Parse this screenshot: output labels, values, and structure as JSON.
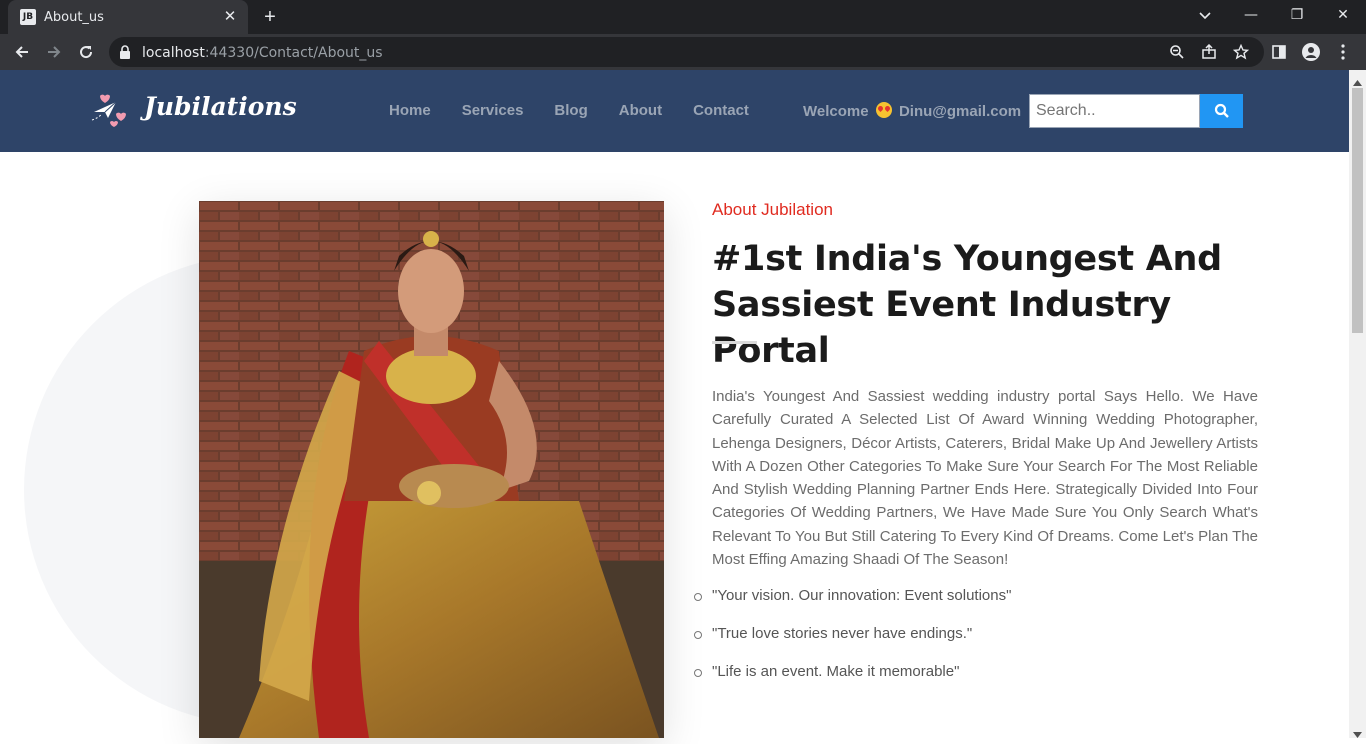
{
  "browser": {
    "tab_title": "About_us",
    "favicon_text": "JB",
    "url_host": "localhost",
    "url_rest": ":44330/Contact/About_us"
  },
  "site": {
    "logo_text": "Jubilations",
    "nav": [
      "Home",
      "Services",
      "Blog",
      "About",
      "Contact"
    ],
    "welcome_prefix": "Welcome",
    "welcome_user": "Dinu@gmail.com",
    "search_placeholder": "Search..",
    "colors": {
      "header": "#2e4468",
      "accent": "#e02b20",
      "search_button": "#2196f3"
    }
  },
  "about": {
    "eyebrow": "About Jubilation",
    "headline_line1": "#1st India's Youngest And",
    "headline_line2": "Sassiest Event Industry Portal",
    "paragraph": "India's Youngest And Sassiest wedding industry portal Says Hello. We Have Carefully Curated A Selected List Of Award Winning Wedding Photographer, Lehenga Designers, Décor Artists, Caterers, Bridal Make Up And Jewellery Artists With A Dozen Other Categories To Make Sure Your Search For The Most Reliable And Stylish Wedding Planning Partner Ends Here. Strategically Divided Into Four Categories Of Wedding Partners, We Have Made Sure You Only Search What's Relevant To You But Still Catering To Every Kind Of Dreams. Come Let's Plan The Most Effing Amazing Shaadi Of The Season!",
    "quotes": [
      "\"Your vision. Our innovation: Event solutions\"",
      "\"True love stories never have endings.\"",
      "\"Life is an event. Make it memorable\""
    ]
  }
}
